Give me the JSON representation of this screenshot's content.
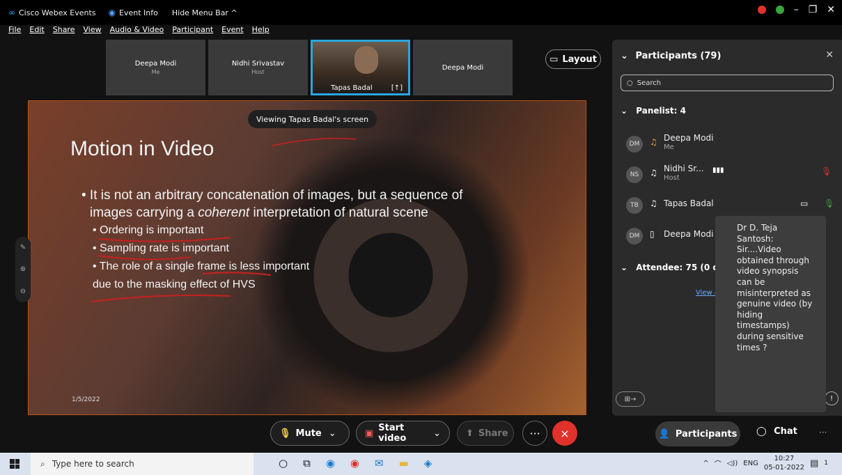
{
  "titlebar": {
    "app_name": "Cisco Webex Events",
    "event_info": "Event Info",
    "hide_menu": "Hide Menu Bar ^"
  },
  "menu": [
    "File",
    "Edit",
    "Share",
    "View",
    "Audio & Video",
    "Participant",
    "Event",
    "Help"
  ],
  "video_strip": [
    {
      "name": "Deepa Modi",
      "sub": "Me"
    },
    {
      "name": "Nidhi Srivastav",
      "sub": "Host"
    },
    {
      "name": "Tapas Badal",
      "sub": ""
    },
    {
      "name": "Deepa Modi",
      "sub": ""
    }
  ],
  "layout_label": "Layout",
  "viewing_label": "Viewing Tapas Badal's screen",
  "slide": {
    "title": "Motion in Video",
    "bullet_main_1": "• It is not an arbitrary concatenation of images, but a sequence of",
    "bullet_main_2_pre": "images carrying a ",
    "bullet_main_2_em": "coherent",
    "bullet_main_2_post": " interpretation of natural scene",
    "sub_bullets": [
      "• Ordering is important",
      "• Sampling rate is important",
      "• The role of a single frame is less important"
    ],
    "sub_cont": "due to the masking effect of HVS",
    "date": "1/5/2022"
  },
  "controls": {
    "mute": "Mute",
    "start_video": "Start video",
    "share": "Share",
    "more": "···",
    "leave": "×"
  },
  "panel": {
    "title": "Participants (79)",
    "search_placeholder": "Search",
    "panelist_group": "Panelist: 4",
    "attendee_group": "Attendee: 75 (0 di",
    "view_all": "View a",
    "participants": [
      {
        "initials": "DM",
        "name": "Deepa Modi",
        "role": "Me"
      },
      {
        "initials": "NS",
        "name": "Nidhi Sr...",
        "role": "Host"
      },
      {
        "initials": "TB",
        "name": "Tapas Badal",
        "role": ""
      },
      {
        "initials": "DM",
        "name": "Deepa Modi",
        "role": ""
      }
    ]
  },
  "tooltip": "Dr D. Teja Santosh: Sir....Video obtained through video synopsis can be misinterpreted as genuine video (by hiding timestamps) during sensitive times ?",
  "bottom_right": {
    "participants_label": "Participants",
    "chat_label": "Chat",
    "more": "···"
  },
  "taskbar": {
    "search_placeholder": "Type here to search",
    "lang": "ENG",
    "time": "10:27",
    "date": "05-01-2022",
    "notifications": "1"
  },
  "colors": {
    "accent_blue": "#29a7e0",
    "leave_red": "#e0312b",
    "slide_border": "#b5541a",
    "ink_red": "#c8201e"
  }
}
